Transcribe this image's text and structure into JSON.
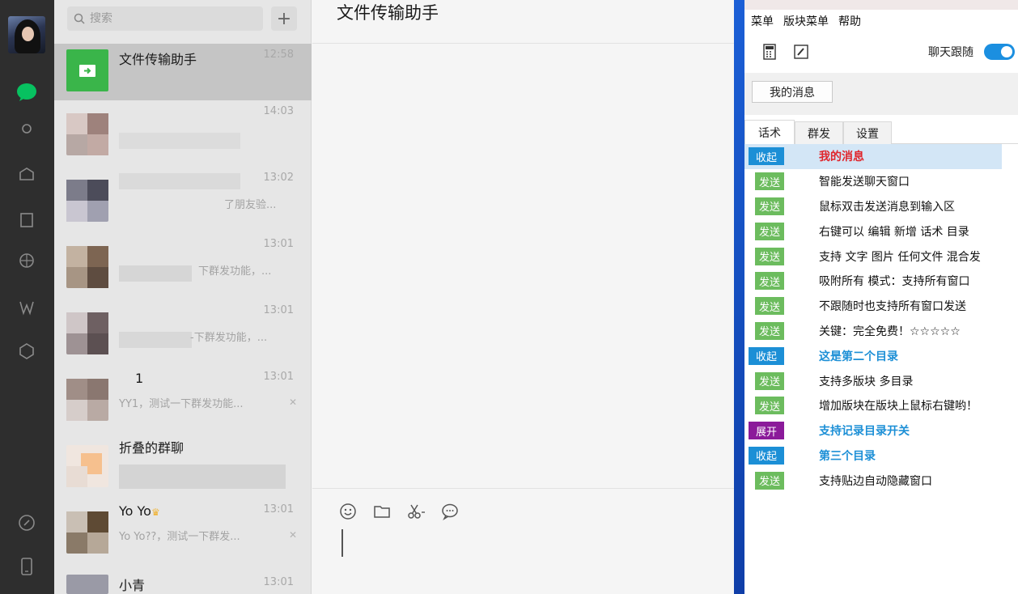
{
  "search": {
    "placeholder": "搜索"
  },
  "chats": [
    {
      "name": "文件传输助手",
      "time": "12:58",
      "preview": "",
      "active": true
    },
    {
      "name": "",
      "time": "14:03",
      "preview": ""
    },
    {
      "name": "",
      "time": "13:02",
      "preview": "了朋友验..."
    },
    {
      "name": "",
      "time": "13:01",
      "preview": "下群发功能，..."
    },
    {
      "name": "",
      "time": "13:01",
      "preview": "-下群发功能，..."
    },
    {
      "name": "1",
      "time": "13:01",
      "preview": "YY1，测试一下群发功能..."
    },
    {
      "name": "折叠的群聊",
      "time": "",
      "preview": ""
    },
    {
      "name": "Yo  Yo",
      "time": "13:01",
      "preview": "Yo  Yo??，测试一下群发..."
    },
    {
      "name": "小青",
      "time": "13:01",
      "preview": ""
    }
  ],
  "main": {
    "title": "文件传输助手"
  },
  "panel": {
    "menu": [
      "菜单",
      "版块菜单",
      "帮助"
    ],
    "follow_label": "聊天跟随",
    "follow_on": true,
    "my_messages_button": "我的消息",
    "tabs": [
      "话术",
      "群发",
      "设置"
    ],
    "rows": [
      {
        "tag": "收起",
        "kind": "fold",
        "text": "我的消息",
        "style": "cat-red"
      },
      {
        "tag": "发送",
        "kind": "send",
        "text": "智能发送聊天窗口"
      },
      {
        "tag": "发送",
        "kind": "send",
        "text": "鼠标双击发送消息到输入区"
      },
      {
        "tag": "发送",
        "kind": "send",
        "text": "右键可以 编辑 新增 话术 目录"
      },
      {
        "tag": "发送",
        "kind": "send",
        "text": "支持 文字 图片 任何文件 混合发"
      },
      {
        "tag": "发送",
        "kind": "send",
        "text": "吸附所有 模式：支持所有窗口"
      },
      {
        "tag": "发送",
        "kind": "send",
        "text": "不跟随时也支持所有窗口发送"
      },
      {
        "tag": "发送",
        "kind": "send",
        "text": "关键：完全免费！☆☆☆☆☆"
      },
      {
        "tag": "收起",
        "kind": "fold",
        "text": "这是第二个目录",
        "style": "cat-blue"
      },
      {
        "tag": "发送",
        "kind": "send",
        "text": "支持多版块 多目录"
      },
      {
        "tag": "发送",
        "kind": "send",
        "text": "增加版块在版块上鼠标右键哟！"
      },
      {
        "tag": "展开",
        "kind": "open",
        "text": "支持记录目录开关",
        "style": "cat-blue"
      },
      {
        "tag": "收起",
        "kind": "fold",
        "text": "第三个目录",
        "style": "cat-blue"
      },
      {
        "tag": "发送",
        "kind": "send",
        "text": "支持贴边自动隐藏窗口"
      }
    ]
  },
  "colors": {
    "rail": "#2e2e2e",
    "accent_green": "#07c160",
    "plugin_blue": "#1c8fd6",
    "send_green": "#6cbc5e"
  }
}
